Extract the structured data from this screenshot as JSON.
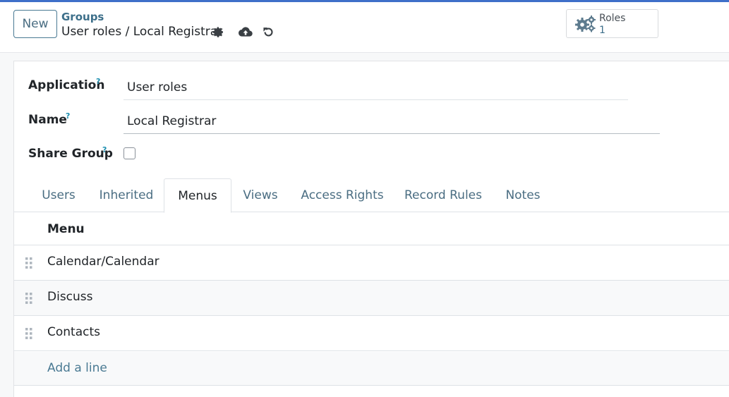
{
  "control_panel": {
    "new_button": "New",
    "breadcrumb_parent": "Groups",
    "breadcrumb_current": "User roles / Local Registrar",
    "icons": [
      "gear-icon",
      "cloud-upload-icon",
      "undo-icon"
    ],
    "stat_button": {
      "label": "Roles",
      "value": "1",
      "icon": "gears-icon"
    }
  },
  "form": {
    "application": {
      "label": "Application",
      "help": "?",
      "value": "User roles"
    },
    "name": {
      "label": "Name",
      "help": "?",
      "value": "Local Registrar"
    },
    "share_group": {
      "label": "Share Group",
      "help": "?",
      "checked": false
    }
  },
  "tabs": [
    {
      "label": "Users"
    },
    {
      "label": "Inherited"
    },
    {
      "label": "Menus",
      "active": true
    },
    {
      "label": "Views"
    },
    {
      "label": "Access Rights"
    },
    {
      "label": "Record Rules"
    },
    {
      "label": "Notes"
    }
  ],
  "menus_table": {
    "header": "Menu",
    "rows": [
      "Calendar/Calendar",
      "Discuss",
      "Contacts"
    ],
    "add_line": "Add a line"
  },
  "colors": {
    "accent": "#3e6fc9",
    "link": "#4a7a93",
    "help": "#1d8fb0"
  }
}
